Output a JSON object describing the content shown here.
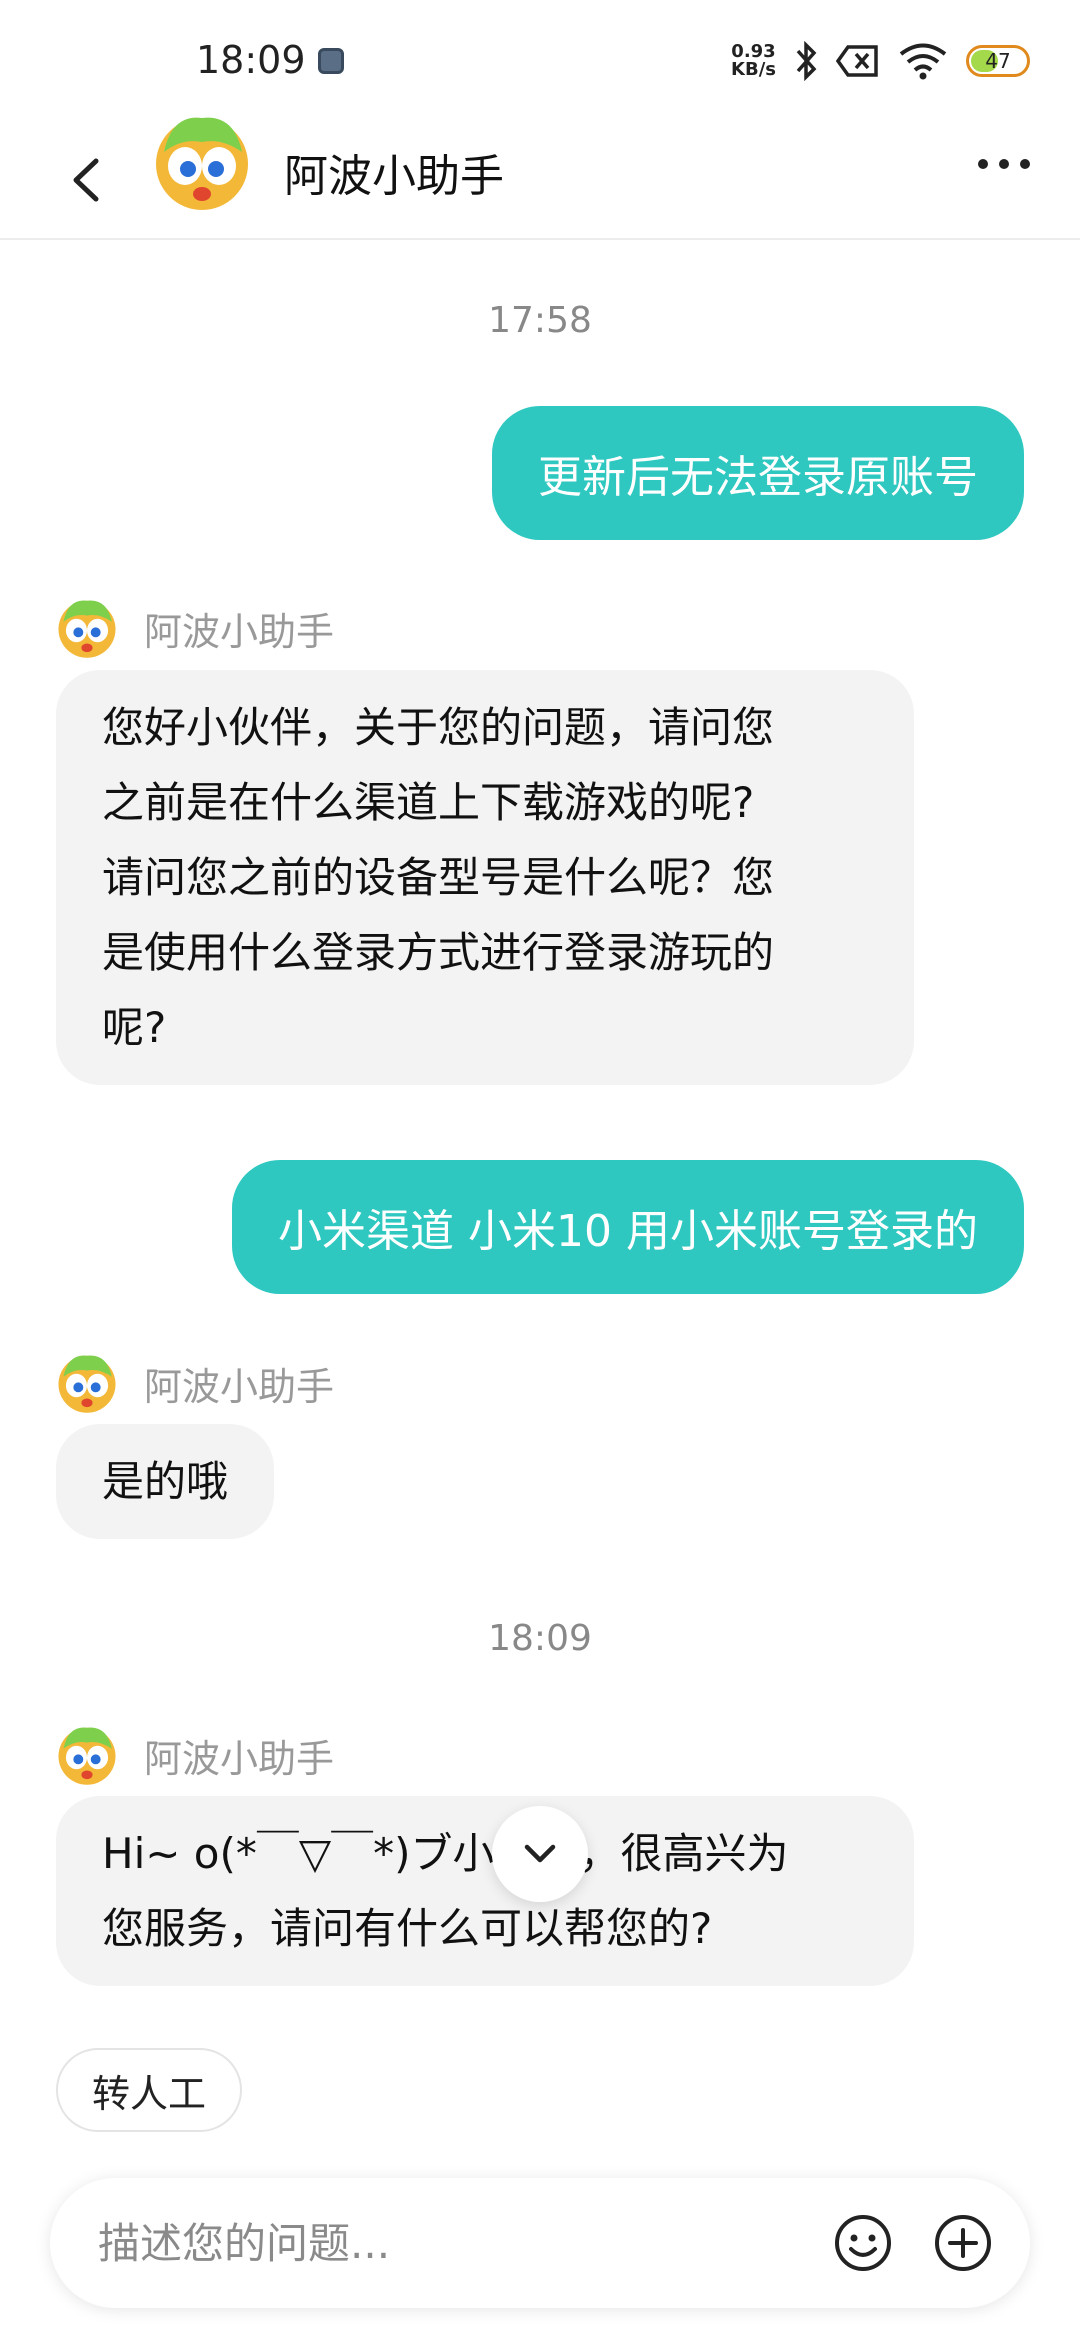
{
  "status": {
    "time": "18:09",
    "net_speed_value": "0.93",
    "net_speed_unit": "KB/s",
    "battery": "47"
  },
  "header": {
    "title": "阿波小助手"
  },
  "chat": {
    "ts1": "17:58",
    "msg1": "更新后无法登录原账号",
    "sender": "阿波小助手",
    "reply1_line1": "您好小伙伴，关于您的问题，请问您",
    "reply1_line2": "之前是在什么渠道上下载游戏的呢?",
    "reply1_line3": "请问您之前的设备型号是什么呢？您",
    "reply1_line4": "是使用什么登录方式进行登录游玩的",
    "reply1_line5": "呢?",
    "msg2": "小米渠道 小米10 用小米账号登录的",
    "reply2": "是的哦",
    "ts2": "18:09",
    "reply3_line1": "Hi~ o(*￣▽￣*)ブ小伙伴，很高兴为",
    "reply3_line2": "您服务，请问有什么可以帮您的?"
  },
  "quick_reply": {
    "label": "转人工"
  },
  "input": {
    "placeholder": "描述您的问题..."
  }
}
